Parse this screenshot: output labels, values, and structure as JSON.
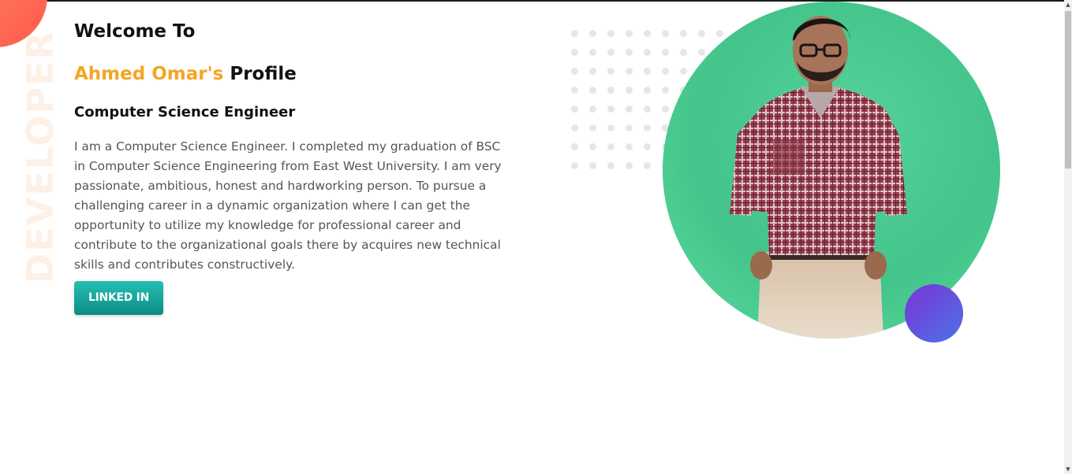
{
  "decor": {
    "vertical_word": "DEVELOPER"
  },
  "hero": {
    "welcome": "Welcome To",
    "name": "Ahmed Omar's",
    "profile_word": "Profile",
    "subtitle": "Computer Science Engineer",
    "bio": "I am a Computer Science Engineer. I completed my graduation of BSC in Computer Science Engineering from East West University. I am very passionate, ambitious, honest and hardworking person. To pursue a challenging career in a dynamic organization where I can get the opportunity to utilize my knowledge for professional career and contribute to the organizational goals there by acquires new technical skills and contributes constructively.",
    "linkedin_label": "LINKED IN"
  },
  "colors": {
    "accent_name": "#f5a524",
    "button_teal": "#1aa9a0",
    "hero_circle": "#43c48a",
    "accent_circle": "#5a58e0",
    "corner_blob": "#ff6b55"
  },
  "icons": {
    "scroll_up": "triangle-up-icon",
    "scroll_down": "triangle-down-icon"
  }
}
